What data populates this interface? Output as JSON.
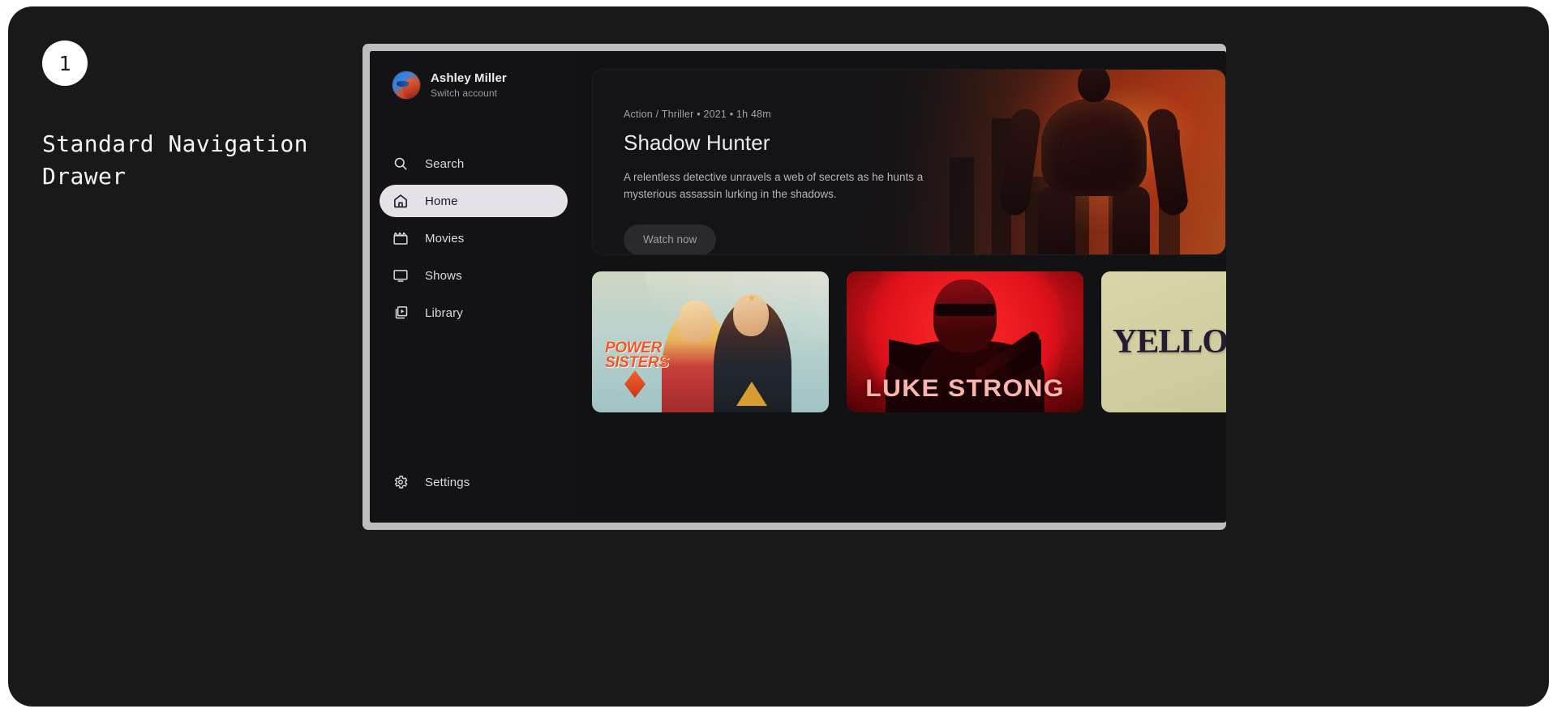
{
  "annotation": {
    "step_number": "1",
    "title": "Standard Navigation Drawer"
  },
  "drawer": {
    "profile": {
      "name": "Ashley Miller",
      "action": "Switch account",
      "avatar_icon": "user-avatar-portrait"
    },
    "items": [
      {
        "label": "Search",
        "icon": "search-icon",
        "selected": false
      },
      {
        "label": "Home",
        "icon": "home-icon",
        "selected": true
      },
      {
        "label": "Movies",
        "icon": "movie-clapper-icon",
        "selected": false
      },
      {
        "label": "Shows",
        "icon": "tv-monitor-icon",
        "selected": false
      },
      {
        "label": "Library",
        "icon": "video-library-icon",
        "selected": false
      }
    ],
    "bottom_item": {
      "label": "Settings",
      "icon": "gear-icon",
      "selected": false
    },
    "selected_pill_color": "#e6e0e9"
  },
  "hero": {
    "meta": "Action / Thriller • 2021 • 1h 48m",
    "title": "Shadow Hunter",
    "description": "A relentless detective unravels a web of secrets as he hunts a mysterious assassin lurking in the shadows.",
    "button_label": "Watch now",
    "artwork_alt": "superhero-silhouette-orange-city"
  },
  "cards": [
    {
      "title": "POWER SISTERS",
      "title_line1": "POWER",
      "title_line2": "SISTERS",
      "artwork_alt": "two-female-superheroes-poster"
    },
    {
      "title": "LUKE STRONG",
      "artwork_alt": "man-with-sunglasses-red-poster"
    },
    {
      "title": "YELLOW",
      "artwork_alt": "yellow-serif-title-poster"
    }
  ],
  "colors": {
    "page_background": "#191919",
    "device_bezel": "#bdbdbd",
    "app_background": "#121214",
    "drawer_background": "#131316",
    "accent_selected": "#e6e0e9",
    "text_primary": "#ededed",
    "text_secondary": "#9a9a9f"
  }
}
